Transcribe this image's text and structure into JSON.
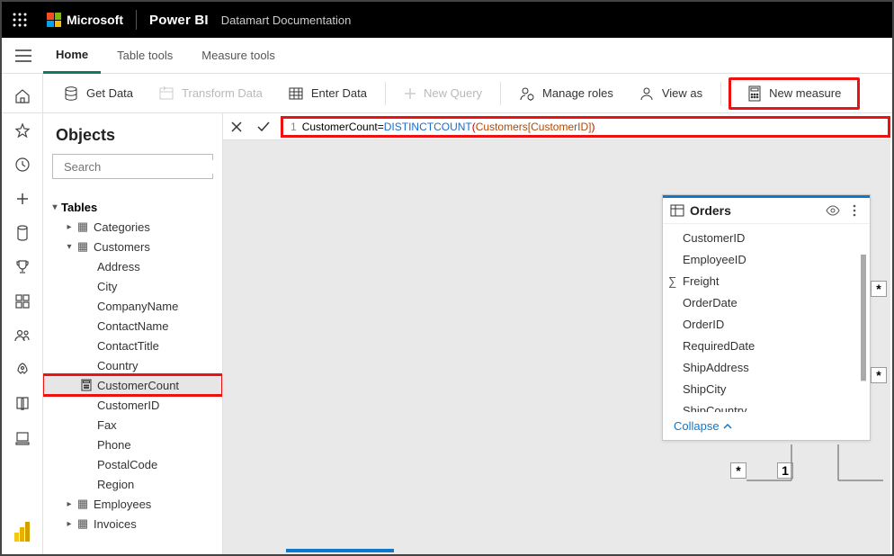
{
  "header": {
    "brand": "Microsoft",
    "app": "Power BI",
    "doc": "Datamart Documentation"
  },
  "tabs": {
    "home": "Home",
    "table_tools": "Table tools",
    "measure_tools": "Measure tools"
  },
  "toolbar": {
    "get_data": "Get Data",
    "transform_data": "Transform Data",
    "enter_data": "Enter Data",
    "new_query": "New Query",
    "manage_roles": "Manage roles",
    "view_as": "View as",
    "new_measure": "New measure"
  },
  "formula": {
    "name": "CustomerCount",
    "eq": " = ",
    "fn": "DISTINCTCOUNT",
    "open": "(",
    "ref": "Customers[CustomerID]",
    "close": ")"
  },
  "sidebar": {
    "title": "Objects",
    "search_placeholder": "Search",
    "tables_label": "Tables",
    "categories": "Categories",
    "customers": "Customers",
    "fields": {
      "address": "Address",
      "city": "City",
      "companyname": "CompanyName",
      "contactname": "ContactName",
      "contacttitle": "ContactTitle",
      "country": "Country",
      "customercount": "CustomerCount",
      "customerid": "CustomerID",
      "fax": "Fax",
      "phone": "Phone",
      "postalcode": "PostalCode",
      "region": "Region"
    },
    "employees": "Employees",
    "invoices": "Invoices"
  },
  "card": {
    "title": "Orders",
    "fields": {
      "customerid": "CustomerID",
      "employeeid": "EmployeeID",
      "freight": "Freight",
      "orderdate": "OrderDate",
      "orderid": "OrderID",
      "requireddate": "RequiredDate",
      "shipaddress": "ShipAddress",
      "shipcity": "ShipCity",
      "shipcountry": "ShipCountry"
    },
    "collapse": "Collapse"
  },
  "asterisk": "*",
  "one": "1"
}
